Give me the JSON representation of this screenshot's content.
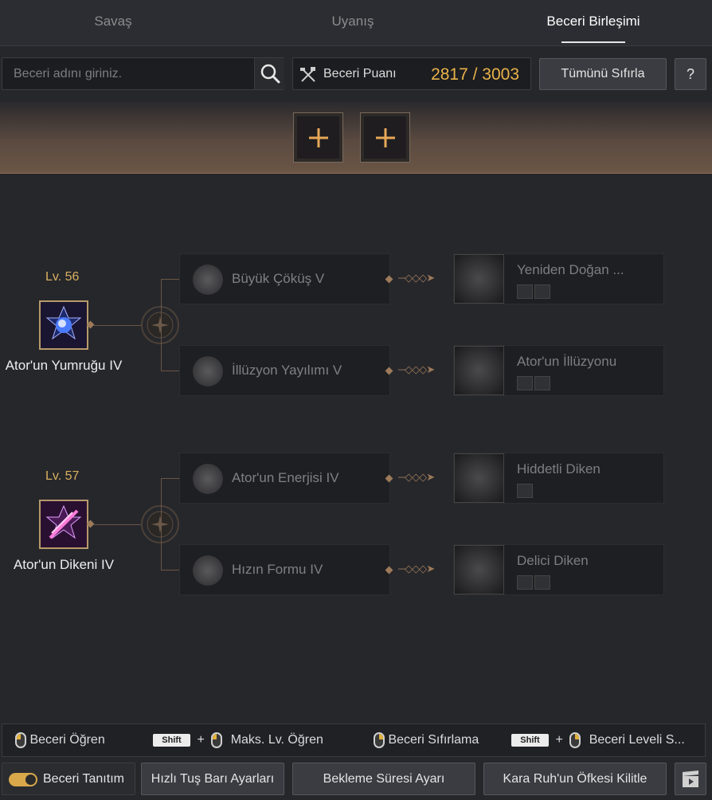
{
  "tabs": [
    {
      "label": "Savaş",
      "active": false
    },
    {
      "label": "Uyanış",
      "active": false
    },
    {
      "label": "Beceri Birleşimi",
      "active": true
    }
  ],
  "search": {
    "placeholder": "Beceri adını giriniz.",
    "icon": "search-icon"
  },
  "points": {
    "label": "Beceri Puanı",
    "value": "2817 / 3003",
    "icon": "crossed-tools-icon",
    "value_color": "#e8b24a"
  },
  "toolbar": {
    "reset_label": "Tümünü Sıfırla",
    "help_label": "?"
  },
  "preset_slots": [
    {
      "icon": "plus-icon"
    },
    {
      "icon": "plus-icon"
    }
  ],
  "groups": [
    {
      "level": "Lv. 56",
      "name": "Ator'un Yumruğu IV",
      "branches": [
        {
          "skill": "Büyük Çöküş V",
          "result": "Yeniden Doğan ...",
          "tags": [
            "claw-icon",
            "feather-icon"
          ]
        },
        {
          "skill": "İllüzyon Yayılımı V",
          "result": "Ator'un İllüzyonu",
          "tags": [
            "claw-icon",
            "feather-icon"
          ]
        }
      ]
    },
    {
      "level": "Lv. 57",
      "name": "Ator'un Dikeni IV",
      "branches": [
        {
          "skill": "Ator'un Enerjisi IV",
          "result": "Hiddetli Diken",
          "tags": [
            "feather-icon"
          ]
        },
        {
          "skill": "Hızın Formu IV",
          "result": "Delici Diken",
          "tags": [
            "claw-icon",
            "feather-icon"
          ]
        }
      ]
    }
  ],
  "help": {
    "learn": "Beceri Öğren",
    "shift": "Shift",
    "plus": "+",
    "max_learn": "Maks. Lv. Öğren",
    "reset": "Beceri Sıfırlama",
    "level_reset": "Beceri Leveli S..."
  },
  "bottom": {
    "intro": "Beceri Tanıtım",
    "hotkey": "Hızlı Tuş Barı Ayarları",
    "cooldown": "Bekleme Süresi Ayarı",
    "lock": "Kara Ruh'un Öfkesi Kilitle",
    "video_icon": "video-icon"
  }
}
